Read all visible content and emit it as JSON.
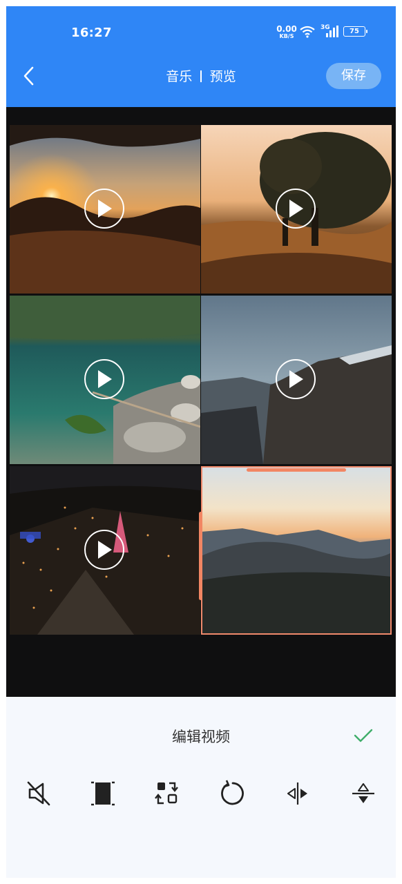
{
  "status_bar": {
    "time": "16:27",
    "net_speed_value": "0.00",
    "net_speed_unit": "KB/S",
    "network_type": "3G",
    "battery": "75"
  },
  "header": {
    "back_icon": "chevron-left-icon",
    "tab_music": "音乐",
    "tab_preview": "预览",
    "save_label": "保存"
  },
  "grid": {
    "clips": [
      {
        "name": "sunset-hills",
        "type": "video"
      },
      {
        "name": "tree-on-hill",
        "type": "video"
      },
      {
        "name": "lake-rocks",
        "type": "video"
      },
      {
        "name": "cliff-mountains",
        "type": "video"
      },
      {
        "name": "night-town",
        "type": "video"
      },
      {
        "name": "mountain-sunset",
        "type": "photo",
        "selected": true
      }
    ]
  },
  "panel": {
    "title": "编辑视频",
    "tools": [
      "mute-icon",
      "crop-icon",
      "replace-icon",
      "rotate-icon",
      "flip-horizontal-icon",
      "flip-vertical-icon"
    ]
  },
  "colors": {
    "header_blue": "#2f86f6",
    "save_button": "#78b4f5",
    "selection_orange": "#f28663",
    "check_green": "#3fae6a"
  }
}
